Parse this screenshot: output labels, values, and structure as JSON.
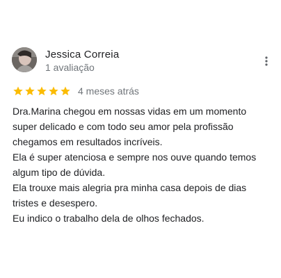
{
  "review": {
    "reviewer_name": "Jessica Correia",
    "review_count": "1 avaliação",
    "rating": 5,
    "rating_max": 5,
    "date": "4 meses atrás",
    "lines": [
      "Dra.Marina chegou em nossas vidas em um momento",
      "super delicado e com todo seu amor pela profissão",
      "chegamos em resultados incríveis.",
      "Ela é super atenciosa e sempre nos ouve quando temos",
      "algum tipo de dúvida.",
      "Ela trouxe mais alegria pra minha casa depois de dias",
      "tristes e desespero.",
      "Eu indico o trabalho dela de olhos fechados."
    ]
  },
  "icons": {
    "more": "more-vert-icon",
    "star": "star-icon"
  },
  "colors": {
    "star": "#fbbc04",
    "name": "#202124",
    "secondary": "#70757a",
    "menu_dots": "#5f6368"
  }
}
